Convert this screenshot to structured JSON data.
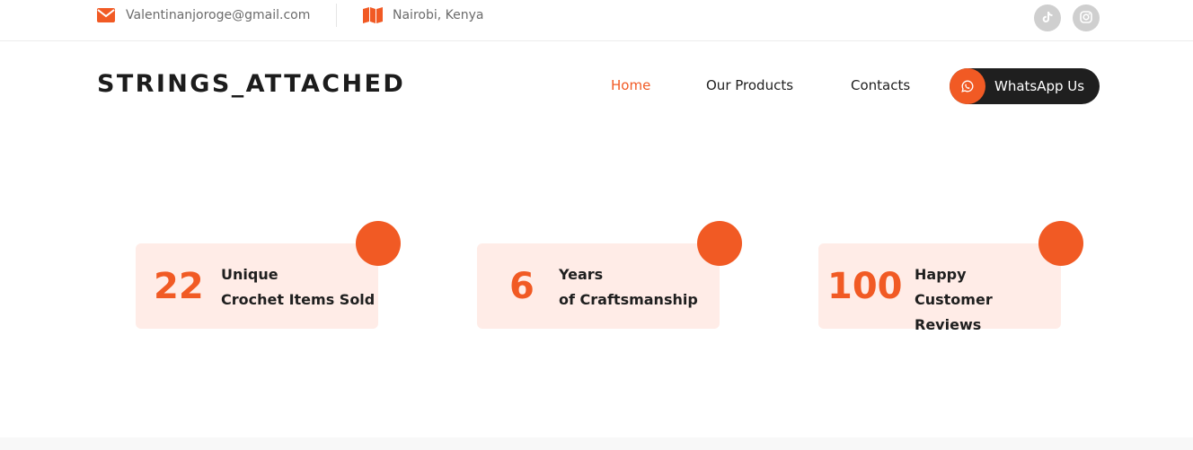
{
  "topbar": {
    "email": "Valentinanjoroge@gmail.com",
    "location": "Nairobi, Kenya",
    "email_icon": "envelope-icon",
    "location_icon": "map-icon",
    "socials": [
      {
        "name": "TikTok",
        "icon": "tiktok-icon"
      },
      {
        "name": "Instagram",
        "icon": "instagram-icon"
      }
    ]
  },
  "header": {
    "brand": "STRINGS_ATTACHED",
    "nav": [
      {
        "label": "Home",
        "active": true
      },
      {
        "label": "Our Products",
        "active": false
      },
      {
        "label": "Contacts",
        "active": false
      }
    ],
    "cta": {
      "label": "WhatsApp Us",
      "icon": "whatsapp-icon"
    }
  },
  "stats": [
    {
      "number": "22",
      "line1": "Unique",
      "line2": "Crochet Items Sold"
    },
    {
      "number": "6",
      "line1": "Years",
      "line2": "of Craftsmanship"
    },
    {
      "number": "100",
      "line1": "Happy",
      "line2": "Customer Reviews"
    }
  ],
  "colors": {
    "accent": "#f15a24",
    "card_bg": "#ffece7",
    "dark": "#1f1f1f",
    "muted_text": "#6b6b6b",
    "social_bg": "#cfcfcf"
  }
}
